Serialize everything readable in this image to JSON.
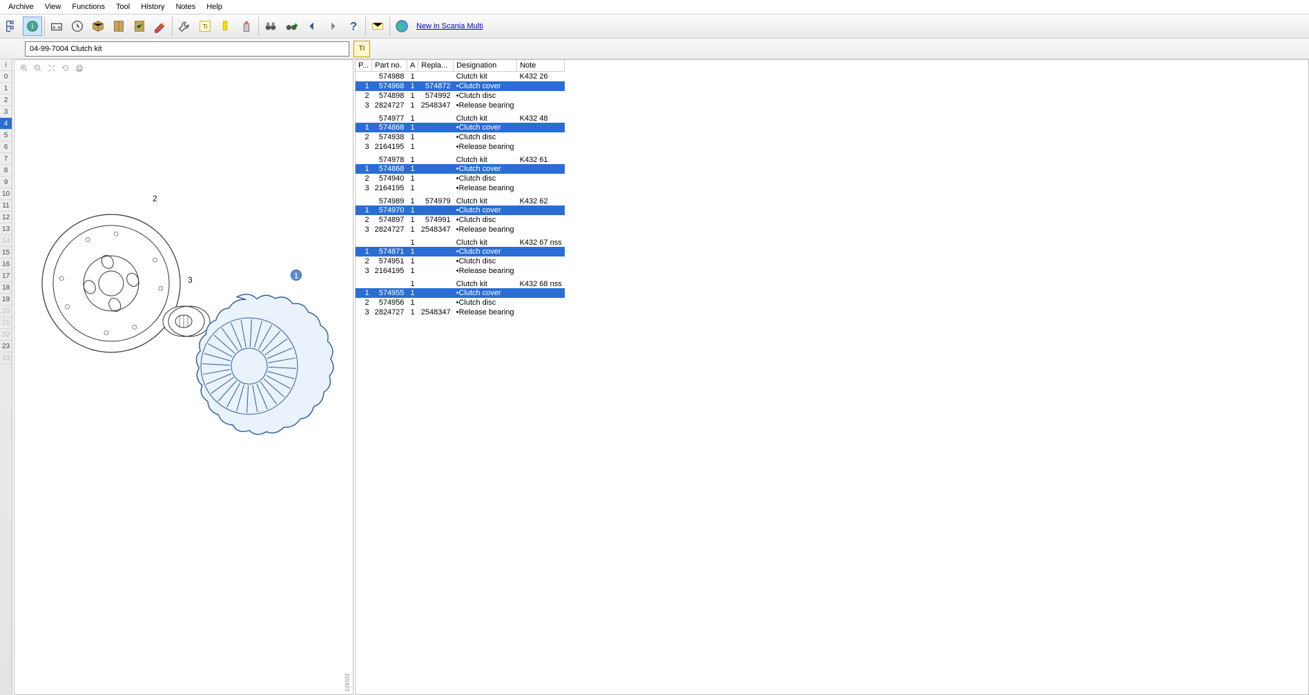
{
  "menu": [
    "Archive",
    "View",
    "Functions",
    "Tool",
    "History",
    "Notes",
    "Help"
  ],
  "link_new": "New in Scania Multi",
  "search_value": "04-99-7004 Clutch kit",
  "ruler": {
    "labels": [
      "i",
      "0",
      "1",
      "2",
      "3",
      "4",
      "5",
      "6",
      "7",
      "8",
      "9",
      "10",
      "11",
      "12",
      "13",
      "14",
      "15",
      "16",
      "17",
      "18",
      "19",
      "20",
      "21",
      "22",
      "23",
      "43"
    ],
    "selected_idx": 5,
    "dim_idx": [
      15,
      21,
      22,
      23,
      25
    ]
  },
  "diagram_ref": "315923",
  "table": {
    "headers": [
      "P...",
      "Part no.",
      "A",
      "Repla...",
      "Designation",
      "Note"
    ],
    "groups": [
      {
        "kit": {
          "p": "",
          "part": "574988",
          "a": "1",
          "rep": "",
          "des": "Clutch kit",
          "note": "K432 26"
        },
        "rows": [
          {
            "p": "1",
            "part": "574968",
            "a": "1",
            "rep": "574872",
            "des": "•Clutch cover",
            "note": "",
            "sel": true
          },
          {
            "p": "2",
            "part": "574898",
            "a": "1",
            "rep": "574992",
            "des": "•Clutch disc",
            "note": ""
          },
          {
            "p": "3",
            "part": "2824727",
            "a": "1",
            "rep": "2548347",
            "des": "•Release bearing",
            "note": ""
          }
        ]
      },
      {
        "kit": {
          "p": "",
          "part": "574977",
          "a": "1",
          "rep": "",
          "des": "Clutch kit",
          "note": "K432 48"
        },
        "rows": [
          {
            "p": "1",
            "part": "574868",
            "a": "1",
            "rep": "",
            "des": "•Clutch cover",
            "note": "",
            "sel": true
          },
          {
            "p": "2",
            "part": "574938",
            "a": "1",
            "rep": "",
            "des": "•Clutch disc",
            "note": ""
          },
          {
            "p": "3",
            "part": "2164195",
            "a": "1",
            "rep": "",
            "des": "•Release bearing",
            "note": ""
          }
        ]
      },
      {
        "kit": {
          "p": "",
          "part": "574978",
          "a": "1",
          "rep": "",
          "des": "Clutch kit",
          "note": "K432 61"
        },
        "rows": [
          {
            "p": "1",
            "part": "574868",
            "a": "1",
            "rep": "",
            "des": "•Clutch cover",
            "note": "",
            "sel": true
          },
          {
            "p": "2",
            "part": "574940",
            "a": "1",
            "rep": "",
            "des": "•Clutch disc",
            "note": ""
          },
          {
            "p": "3",
            "part": "2164195",
            "a": "1",
            "rep": "",
            "des": "•Release bearing",
            "note": ""
          }
        ]
      },
      {
        "kit": {
          "p": "",
          "part": "574989",
          "a": "1",
          "rep": "574979",
          "des": "Clutch kit",
          "note": "K432 62"
        },
        "rows": [
          {
            "p": "1",
            "part": "574970",
            "a": "1",
            "rep": "",
            "des": "•Clutch cover",
            "note": "",
            "sel": true
          },
          {
            "p": "2",
            "part": "574897",
            "a": "1",
            "rep": "574991",
            "des": "•Clutch disc",
            "note": ""
          },
          {
            "p": "3",
            "part": "2824727",
            "a": "1",
            "rep": "2548347",
            "des": "•Release bearing",
            "note": ""
          }
        ]
      },
      {
        "kit": {
          "p": "",
          "part": "",
          "a": "1",
          "rep": "",
          "des": "Clutch kit",
          "note": "K432 67 nss"
        },
        "rows": [
          {
            "p": "1",
            "part": "574871",
            "a": "1",
            "rep": "",
            "des": "•Clutch cover",
            "note": "",
            "sel": true
          },
          {
            "p": "2",
            "part": "574951",
            "a": "1",
            "rep": "",
            "des": "•Clutch disc",
            "note": ""
          },
          {
            "p": "3",
            "part": "2164195",
            "a": "1",
            "rep": "",
            "des": "•Release bearing",
            "note": ""
          }
        ]
      },
      {
        "kit": {
          "p": "",
          "part": "",
          "a": "1",
          "rep": "",
          "des": "Clutch kit",
          "note": "K432 68 nss"
        },
        "rows": [
          {
            "p": "1",
            "part": "574955",
            "a": "1",
            "rep": "",
            "des": "•Clutch cover",
            "note": "",
            "sel": true
          },
          {
            "p": "2",
            "part": "574956",
            "a": "1",
            "rep": "",
            "des": "•Clutch disc",
            "note": ""
          },
          {
            "p": "3",
            "part": "2824727",
            "a": "1",
            "rep": "2548347",
            "des": "•Release bearing",
            "note": ""
          }
        ]
      }
    ]
  }
}
